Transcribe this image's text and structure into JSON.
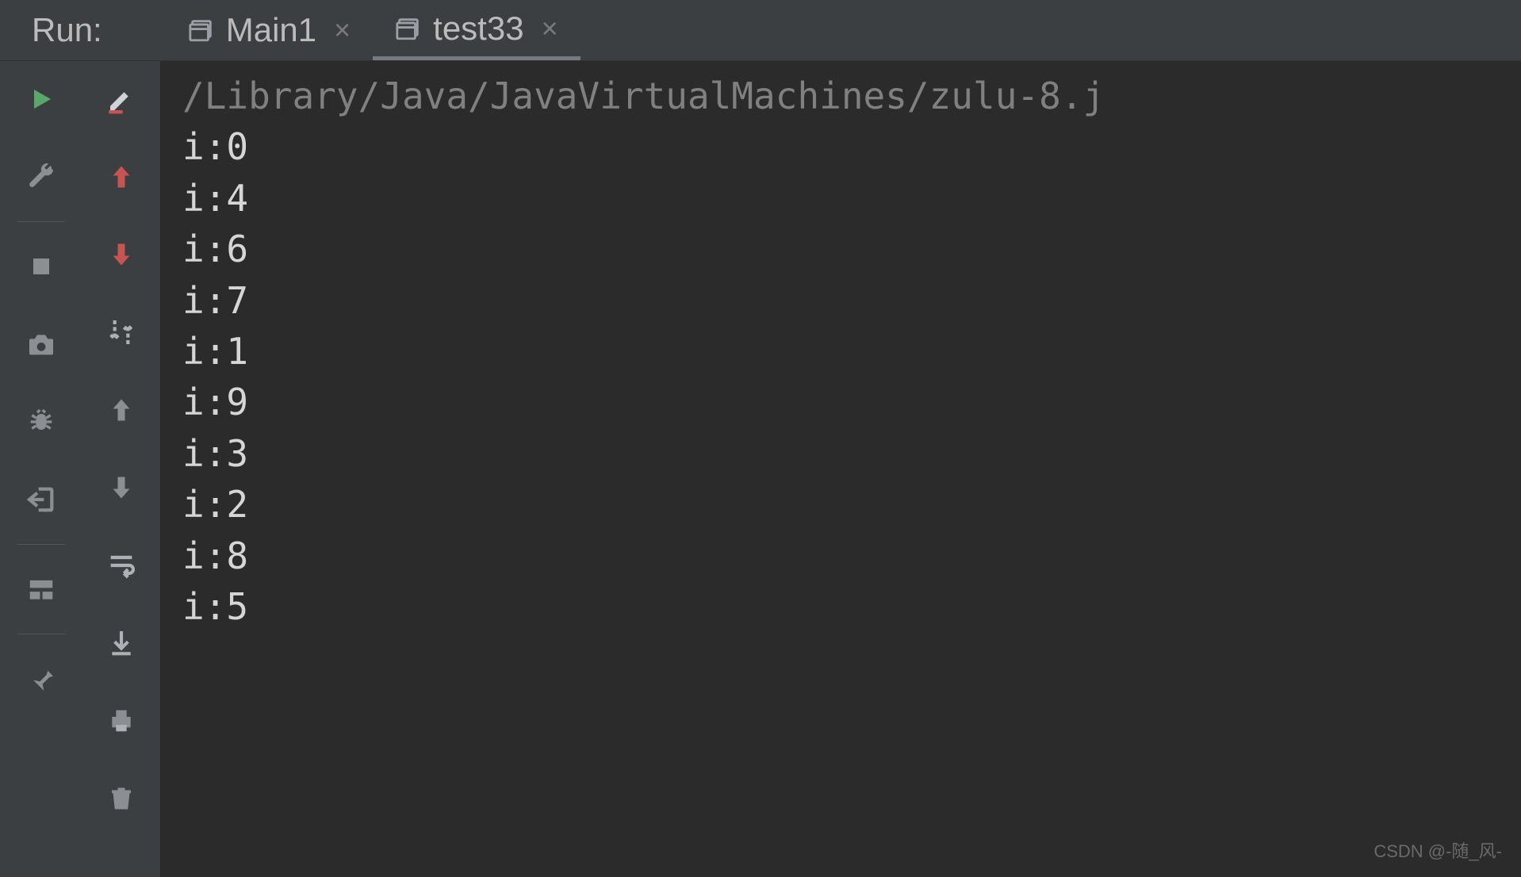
{
  "header": {
    "label": "Run:",
    "tabs": [
      {
        "label": "Main1",
        "active": false
      },
      {
        "label": "test33",
        "active": true
      }
    ]
  },
  "console": {
    "command": "/Library/Java/JavaVirtualMachines/zulu-8.j",
    "output": [
      "i:0",
      "i:4",
      "i:6",
      "i:7",
      "i:1",
      "i:9",
      "i:3",
      "i:2",
      "i:8",
      "i:5"
    ]
  },
  "watermark": "CSDN @-随_风-"
}
